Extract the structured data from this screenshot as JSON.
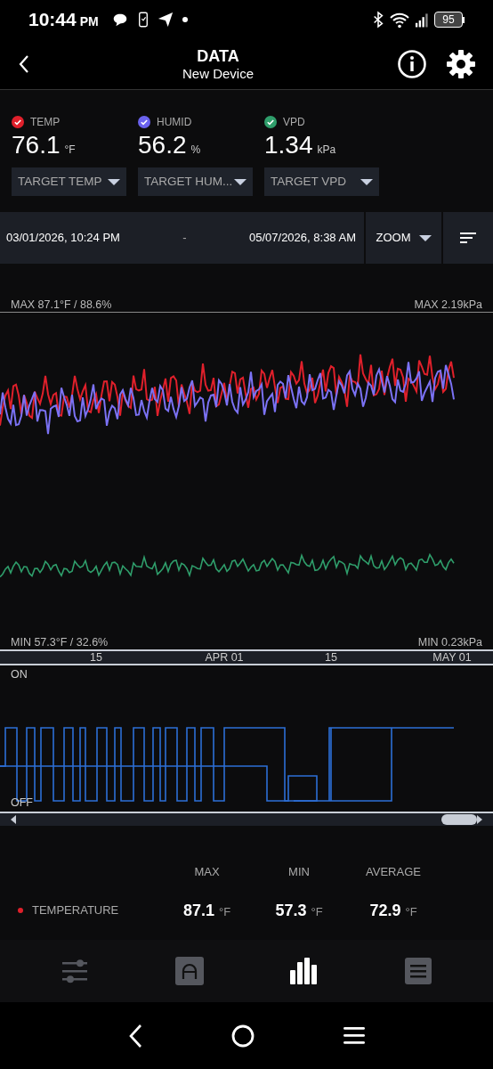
{
  "status_bar": {
    "time": "10:44",
    "meridiem": "PM",
    "battery": "95"
  },
  "header": {
    "title": "DATA",
    "subtitle": "New Device"
  },
  "metrics": [
    {
      "label": "TEMP",
      "value": "76.1",
      "unit": "°F",
      "color": "#e0202b",
      "checked": true,
      "target": "TARGET TEMP"
    },
    {
      "label": "HUMID",
      "value": "56.2",
      "unit": "%",
      "color": "#6a62ee",
      "checked": true,
      "target": "TARGET HUM..."
    },
    {
      "label": "VPD",
      "value": "1.34",
      "unit": "kPa",
      "color": "#2f9e6b",
      "checked": true,
      "target": "TARGET VPD"
    }
  ],
  "date_range": {
    "start": "03/01/2026, 10:24 PM",
    "separator": "-",
    "end": "05/07/2026, 8:38 AM",
    "zoom": "ZOOM"
  },
  "chart": {
    "max_left": "MAX 87.1°F / 88.6%",
    "max_right": "MAX 2.19kPa",
    "min_left": "MIN 57.3°F / 32.6%",
    "min_right": "MIN 0.23kPa",
    "x_labels": [
      "15",
      "APR 01",
      "15",
      "MAY 01"
    ],
    "state_top": "ON",
    "state_bottom": "OFF"
  },
  "stats": {
    "columns": [
      "MAX",
      "MIN",
      "AVERAGE"
    ],
    "rows": [
      {
        "label": "TEMPERATURE",
        "color": "#e0202b",
        "values": [
          {
            "value": "87.1",
            "unit": "°F"
          },
          {
            "value": "57.3",
            "unit": "°F"
          },
          {
            "value": "72.9",
            "unit": "°F"
          }
        ]
      }
    ]
  },
  "nav_tabs": [
    {
      "kind": "sliders",
      "selected": false
    },
    {
      "kind": "arch",
      "selected": false
    },
    {
      "kind": "bars",
      "selected": true
    },
    {
      "kind": "list",
      "selected": false
    }
  ]
}
